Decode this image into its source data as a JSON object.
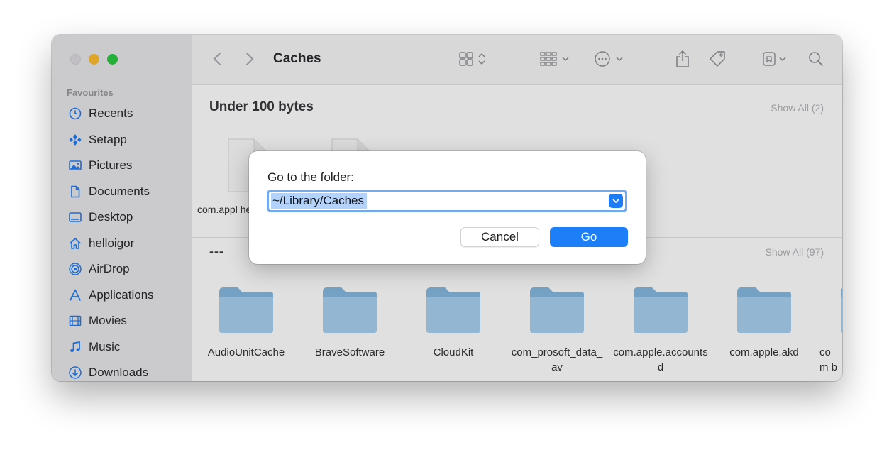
{
  "window": {
    "title": "Caches"
  },
  "sidebar": {
    "heading": "Favourites",
    "items": [
      {
        "label": "Recents",
        "icon": "clock-icon"
      },
      {
        "label": "Setapp",
        "icon": "setapp-icon"
      },
      {
        "label": "Pictures",
        "icon": "photo-icon"
      },
      {
        "label": "Documents",
        "icon": "document-icon"
      },
      {
        "label": "Desktop",
        "icon": "desktop-icon"
      },
      {
        "label": "helloigor",
        "icon": "home-icon"
      },
      {
        "label": "AirDrop",
        "icon": "airdrop-icon"
      },
      {
        "label": "Applications",
        "icon": "applications-icon"
      },
      {
        "label": "Movies",
        "icon": "film-icon"
      },
      {
        "label": "Music",
        "icon": "music-note-icon"
      },
      {
        "label": "Downloads",
        "icon": "download-icon"
      }
    ]
  },
  "sections": [
    {
      "title": "Under 100 bytes",
      "show_all": "Show All (2)",
      "files": [
        {
          "name": "com.appl her.ca"
        },
        {
          "name": ""
        }
      ]
    },
    {
      "title": "---",
      "show_all": "Show All (97)"
    }
  ],
  "folders": [
    {
      "label": "AudioUnitCache"
    },
    {
      "label": "BraveSoftware"
    },
    {
      "label": "CloudKit"
    },
    {
      "label": "com_prosoft_data_av"
    },
    {
      "label": "com.apple.accountsd"
    },
    {
      "label": "com.apple.akd"
    },
    {
      "label": "com b"
    }
  ],
  "dialog": {
    "title": "Go to the folder:",
    "path_value": "~/Library/Caches",
    "cancel_label": "Cancel",
    "go_label": "Go"
  },
  "colors": {
    "accent": "#1c7ff8",
    "folder": "#a8d0f0",
    "selection": "#b3d3fd"
  }
}
